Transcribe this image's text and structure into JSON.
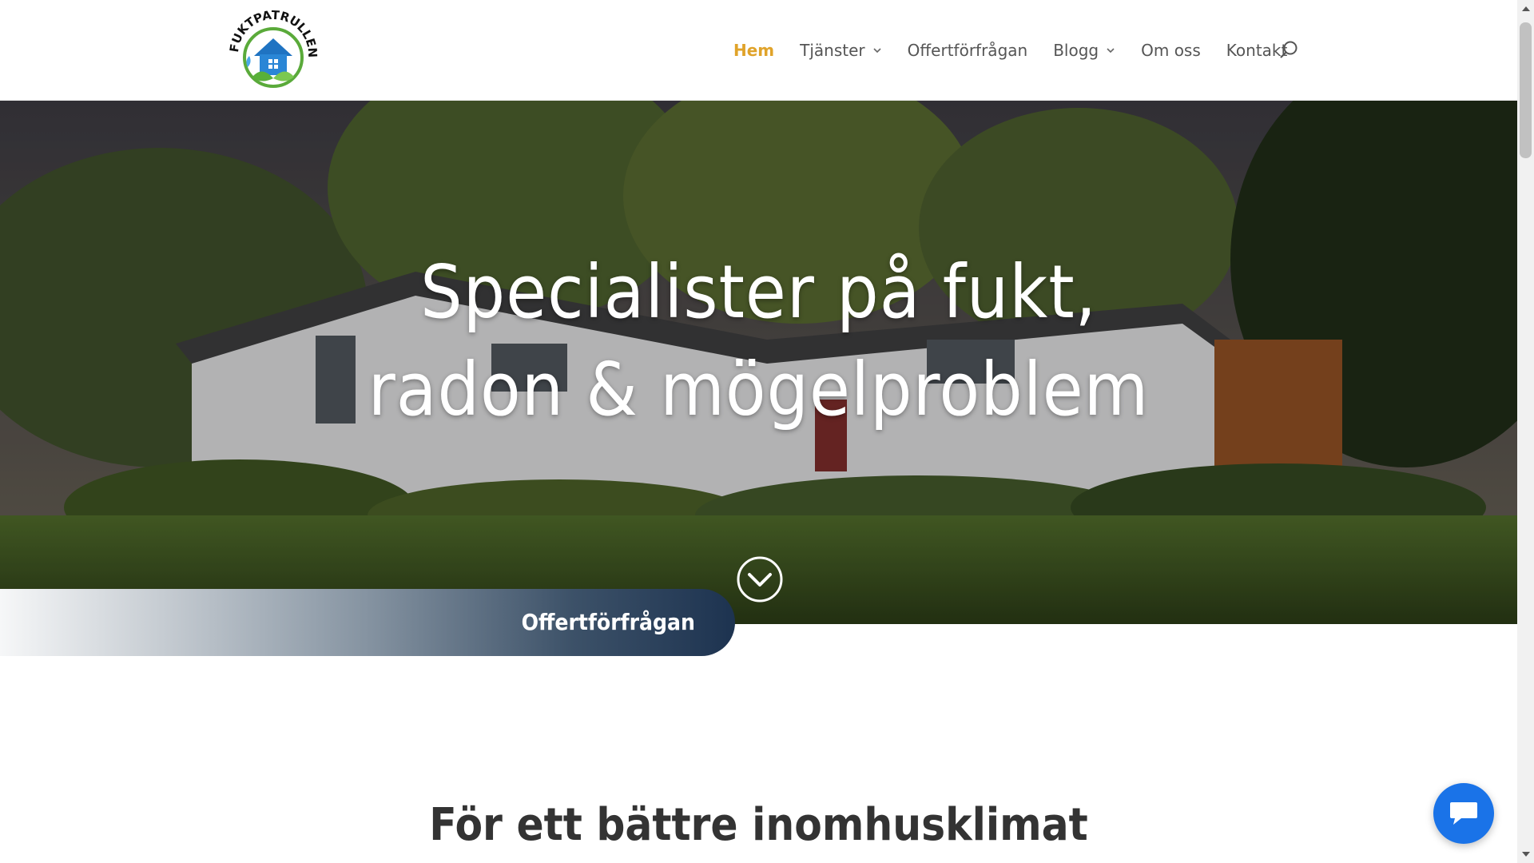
{
  "brand": {
    "logo_text": "FUKTPATRULLEN"
  },
  "nav": {
    "items": [
      {
        "label": "Hem",
        "active": true,
        "dropdown": false
      },
      {
        "label": "Tjänster",
        "active": false,
        "dropdown": true
      },
      {
        "label": "Offertförfrågan",
        "active": false,
        "dropdown": false
      },
      {
        "label": "Blogg",
        "active": false,
        "dropdown": true
      },
      {
        "label": "Om oss",
        "active": false,
        "dropdown": false
      },
      {
        "label": "Kontakt",
        "active": false,
        "dropdown": false
      }
    ],
    "search_icon": "search-icon"
  },
  "hero": {
    "title_line1": "Specialister på fukt,",
    "title_line2": "radon & mögelproblem",
    "scroll_icon": "chevron-down-circle-icon"
  },
  "cta": {
    "label": "Offertförfrågan"
  },
  "section": {
    "title": "För ett bättre inomhusklimat"
  },
  "chat": {
    "icon": "chat-icon",
    "color": "#1a73e8"
  },
  "colors": {
    "accent": "#e0a32a",
    "nav_text": "#555555",
    "cta_dark": "#1d3350"
  }
}
